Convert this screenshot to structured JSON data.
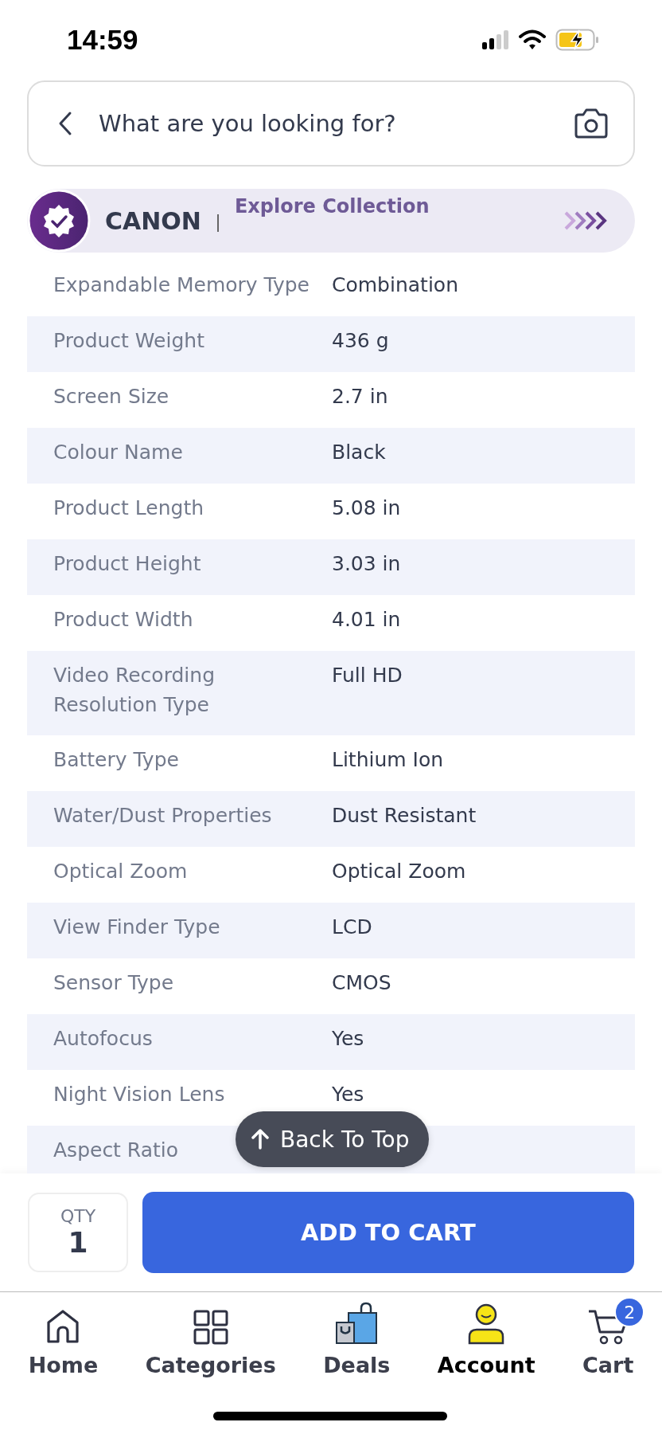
{
  "status_bar": {
    "time": "14:59"
  },
  "search": {
    "placeholder": "What are you looking for?"
  },
  "brand": {
    "name": "CANON",
    "link": "Explore Collection"
  },
  "specs": [
    {
      "label": "Expandable Memory Type",
      "value": "Combination"
    },
    {
      "label": "Product Weight",
      "value": "436 g"
    },
    {
      "label": "Screen Size",
      "value": "2.7 in"
    },
    {
      "label": "Colour Name",
      "value": "Black"
    },
    {
      "label": "Product Length",
      "value": "5.08 in"
    },
    {
      "label": "Product Height",
      "value": "3.03 in"
    },
    {
      "label": "Product Width",
      "value": "4.01 in"
    },
    {
      "label": "Video Recording Resolution Type",
      "value": "Full HD"
    },
    {
      "label": "Battery Type",
      "value": "Lithium Ion"
    },
    {
      "label": "Water/Dust Properties",
      "value": "Dust Resistant"
    },
    {
      "label": "Optical Zoom",
      "value": "Optical Zoom"
    },
    {
      "label": "View Finder Type",
      "value": "LCD"
    },
    {
      "label": "Sensor Type",
      "value": "CMOS"
    },
    {
      "label": "Autofocus",
      "value": "Yes"
    },
    {
      "label": "Night Vision Lens",
      "value": "Yes"
    },
    {
      "label": "Aspect Ratio"
    }
  ],
  "back_to_top": "Back To Top",
  "quantity": {
    "label": "QTY",
    "value": "1"
  },
  "add_to_cart": "ADD TO CART",
  "tabs": [
    {
      "kind": "home",
      "label": "Home",
      "selected": false
    },
    {
      "kind": "categories",
      "label": "Categories",
      "selected": false
    },
    {
      "kind": "deals",
      "label": "Deals",
      "selected": false
    },
    {
      "kind": "account",
      "label": "Account",
      "selected": true
    },
    {
      "kind": "cart",
      "label": "Cart",
      "selected": false,
      "badge": "2"
    }
  ]
}
